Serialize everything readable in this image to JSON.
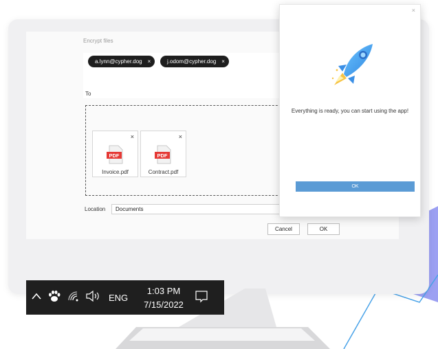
{
  "encrypt_dialog": {
    "title": "Encrypt files",
    "recipients": [
      {
        "email": "a.lynn@cypher.dog",
        "remove": "×"
      },
      {
        "email": "j.odom@cypher.dog",
        "remove": "×"
      }
    ],
    "to_label": "To",
    "files": [
      {
        "name": "Invoice.pdf",
        "badge": "PDF",
        "remove": "×"
      },
      {
        "name": "Contract.pdf",
        "badge": "PDF",
        "remove": "×"
      }
    ],
    "location_label": "Location",
    "location_value": "Documents",
    "cancel_label": "Cancel",
    "ok_label": "OK"
  },
  "popup": {
    "close": "×",
    "message": "Everything is ready, you can start using the app!",
    "ok_label": "OK"
  },
  "taskbar": {
    "language": "ENG",
    "time": "1:03 PM",
    "date": "7/15/2022",
    "icons": [
      "chevron-up-icon",
      "paw-icon",
      "wifi-icon",
      "speaker-icon",
      "notification-icon"
    ]
  },
  "colors": {
    "accent": "#5b9bd5",
    "chip": "#1e1e1e",
    "taskbar": "#1f1f1f",
    "pdf_red": "#e53935"
  }
}
